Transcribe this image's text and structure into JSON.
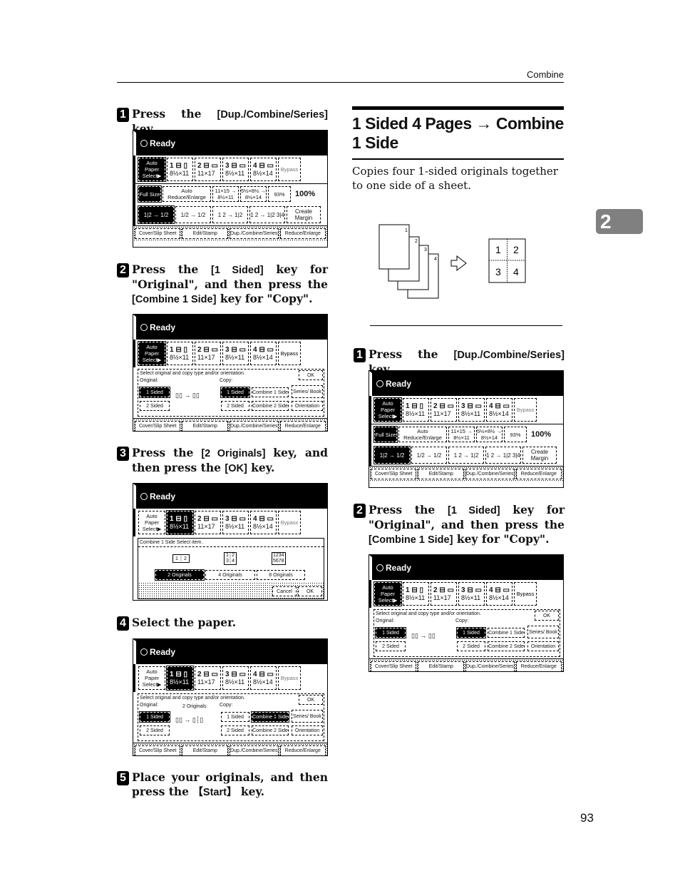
{
  "header": {
    "running_title": "Combine"
  },
  "chapter_tab": "2",
  "page_number": "93",
  "left_steps": [
    {
      "num": "1",
      "text_parts": [
        "Press the ",
        "[Dup./Combine/Series]",
        " key."
      ]
    },
    {
      "num": "2",
      "text_parts": [
        "Press the ",
        "[1 Sided]",
        " key for \"Original\", and then press the ",
        "[Combine 1 Side]",
        " key for \"Copy\"."
      ]
    },
    {
      "num": "3",
      "text_parts": [
        "Press the ",
        "[2 Originals]",
        " key, and then press the ",
        "[OK]",
        " key."
      ]
    },
    {
      "num": "4",
      "text_parts": [
        "Select the paper."
      ]
    },
    {
      "num": "5",
      "text_parts": [
        "Place your originals, and then press the ",
        "【Start】",
        " key."
      ]
    }
  ],
  "section": {
    "title": "1 Sided 4 Pages → Combine 1 Side",
    "intro": "Copies four 1-sided originals together to one side of a sheet."
  },
  "illustration": {
    "source_pages": [
      "1",
      "2",
      "3",
      "4"
    ],
    "result_cells": [
      "1",
      "2",
      "3",
      "4"
    ]
  },
  "right_steps": [
    {
      "num": "1",
      "text_parts": [
        "Press the ",
        "[Dup./Combine/Series]",
        " key."
      ]
    },
    {
      "num": "2",
      "text_parts": [
        "Press the ",
        "[1 Sided]",
        " key for \"Original\", and then press the ",
        "[Combine 1 Side]",
        " key for \"Copy\"."
      ]
    }
  ],
  "screen": {
    "status": "Ready",
    "auto_paper": "Auto Paper Select▶",
    "trays": [
      {
        "label": "1 ⊟ ▯",
        "size": "8½×11"
      },
      {
        "label": "2 ⊟ ▭",
        "size": "11×17"
      },
      {
        "label": "3 ⊟ ▭",
        "size": "8½×11"
      },
      {
        "label": "4 ⊟ ▭",
        "size": "8½×14"
      }
    ],
    "bypass": "Bypass",
    "full_size": "Full Size",
    "auto_reduce": "Auto Reduce/Enlarge",
    "preset1": "11×15 → 8½×11",
    "preset2": "5½×8½ → 8½×14",
    "preset3": "93%",
    "ratio": "100%",
    "modes": [
      "1|2 → 1/2",
      "1/2 → 1/2",
      "1 2 → 1|2",
      "1 2 → 1|2 3|4",
      "Create Margin"
    ],
    "tabs": [
      "Cover/Slip Sheet",
      "Edit/Stamp",
      "Dup./Combine/Series",
      "Reduce/Enlarge"
    ],
    "dup_prompt": "Select original and copy type and/or orientation.",
    "original_label": "Original:",
    "copy_label": "Copy:",
    "orig_1sided": "1 Sided",
    "orig_2sided": "2 Sided",
    "copy_1sided": "1 Sided",
    "copy_2sided": "2 Sided",
    "combine1": "Combine 1 Side",
    "combine2": "Combine 2 Side",
    "series_book": "Series/ Book",
    "orientation": "Orientation",
    "ok": "OK",
    "cancel": "Cancel",
    "two_originals_note": "2 Originals",
    "combine_prompt": "Combine 1 Side   Select item.",
    "originals_options": [
      "2 Originals",
      "4 Originals",
      "8 Originals"
    ]
  }
}
